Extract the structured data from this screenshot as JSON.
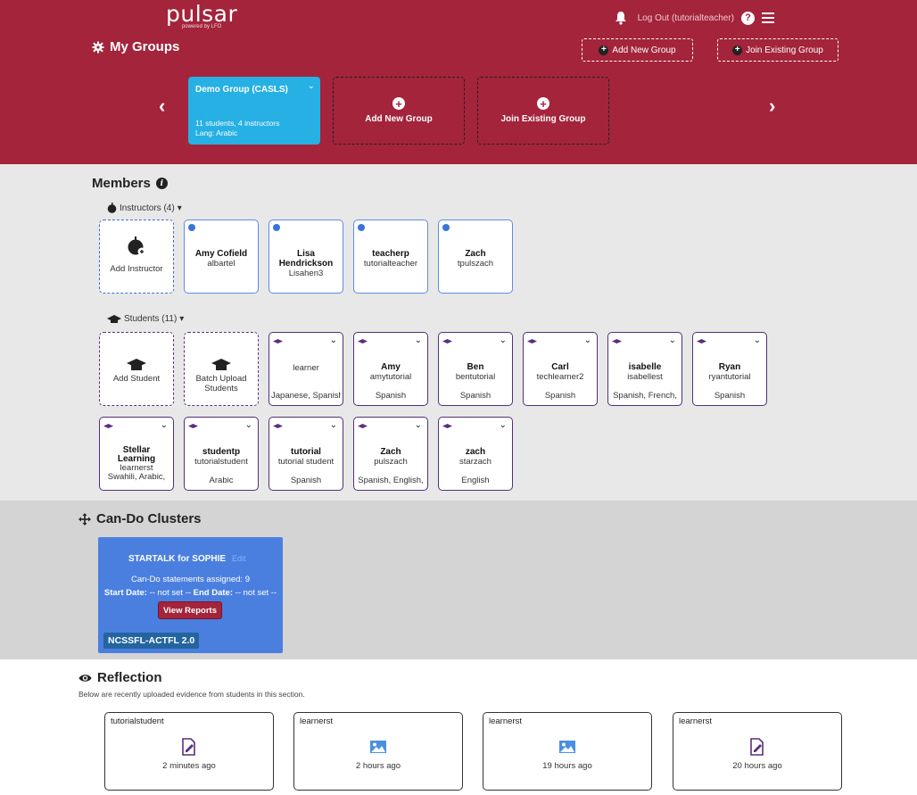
{
  "header": {
    "logo": "pulsar",
    "logo_sub": "powered by LFO",
    "logout": "Log Out (tutorialteacher)",
    "help": "?",
    "title": "My Groups",
    "add_new_group_btn": "Add New Group",
    "join_existing_btn": "Join Existing Group"
  },
  "groups": {
    "active": {
      "name": "Demo Group (CASLS)",
      "counts": "11 students, 4 instructors",
      "lang": "Lang: Arabic"
    },
    "add_label": "Add New Group",
    "join_label": "Join Existing Group"
  },
  "members": {
    "title": "Members",
    "instructors_label": "Instructors (4)",
    "add_instructor": "Add Instructor",
    "instructors": [
      {
        "name": "Amy Cofield",
        "user": "albartel"
      },
      {
        "name": "Lisa Hendrickson",
        "user": "Lisahen3"
      },
      {
        "name": "teacherp",
        "user": "tutorialteacher"
      },
      {
        "name": "Zach",
        "user": "tpulszach"
      }
    ],
    "students_label": "Students (11)",
    "add_student": "Add Student",
    "batch_upload": "Batch Upload Students",
    "students": [
      {
        "name": "",
        "user": "learner",
        "lang": "Japanese, Spanish,"
      },
      {
        "name": "Amy",
        "user": "amytutorial",
        "lang": "Spanish"
      },
      {
        "name": "Ben",
        "user": "bentutorial",
        "lang": "Spanish"
      },
      {
        "name": "Carl",
        "user": "techlearner2",
        "lang": "Spanish"
      },
      {
        "name": "isabelle",
        "user": "isabellest",
        "lang": "Spanish, French,"
      },
      {
        "name": "Ryan",
        "user": "ryantutorial",
        "lang": "Spanish"
      },
      {
        "name": "Stellar Learning",
        "user": "learnerst",
        "lang": "Swahili, Arabic,"
      },
      {
        "name": "studentp",
        "user": "tutorialstudent",
        "lang": "Arabic"
      },
      {
        "name": "tutorial",
        "user": "tutorial student",
        "lang": "Spanish"
      },
      {
        "name": "Zach",
        "user": "pulszach",
        "lang": "Spanish, English,"
      },
      {
        "name": "zach",
        "user": "starzach",
        "lang": "English"
      }
    ]
  },
  "cando": {
    "title": "Can-Do Clusters",
    "cluster": {
      "name": "STARTALK for SOPHIE",
      "edit": "Edit",
      "assigned": "Can-Do statements assigned: 9",
      "start_label": "Start Date:",
      "start_value": " -- not set -- ",
      "end_label": "End Date:",
      "end_value": " -- not set --",
      "view_reports": "View Reports",
      "badge": "NCSSFL-ACTFL 2.0"
    }
  },
  "reflection": {
    "title": "Reflection",
    "subtitle": "Below are recently uploaded evidence from students in this section.",
    "items": [
      {
        "user": "tutorialstudent",
        "icon": "document-edit-icon",
        "time": "2 minutes ago"
      },
      {
        "user": "learnerst",
        "icon": "image-icon",
        "time": "2 hours ago"
      },
      {
        "user": "learnerst",
        "icon": "image-icon",
        "time": "19 hours ago"
      },
      {
        "user": "learnerst",
        "icon": "document-edit-icon",
        "time": "20 hours ago"
      }
    ]
  },
  "colors": {
    "header": "#a3243b",
    "active_group": "#26b0e3",
    "cluster": "#4a7fe0",
    "student_border": "#53307a",
    "instructor_border": "#5e8ce8"
  }
}
